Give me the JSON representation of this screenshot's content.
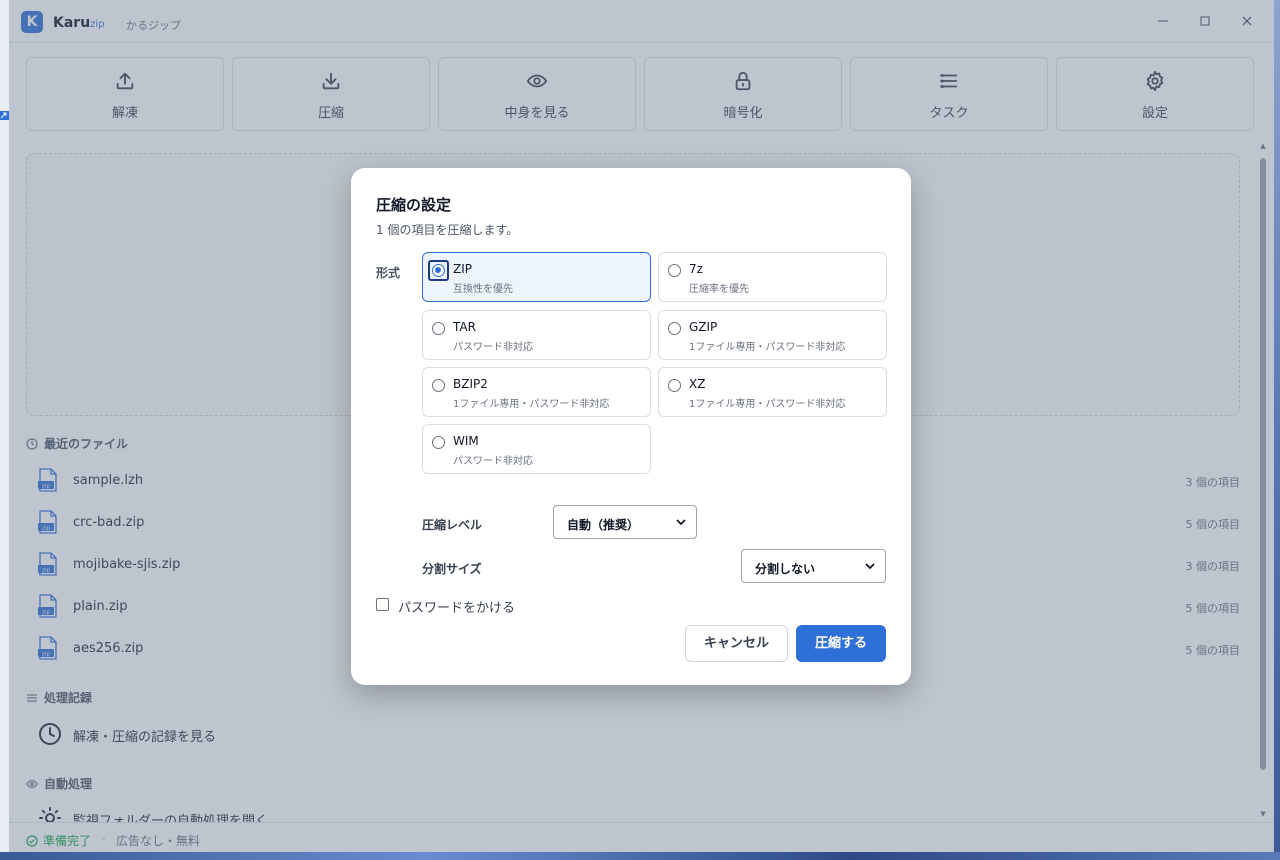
{
  "app": {
    "logo_letter": "K",
    "name": "Karu",
    "name_suffix": "zip",
    "kana": "かるジップ",
    "accent": "#2f6fd8"
  },
  "window_controls": {
    "minimize": "—",
    "maximize": "□",
    "close": "✕"
  },
  "toolbar": [
    {
      "label": "解凍",
      "icon": "upload-icon"
    },
    {
      "label": "圧縮",
      "icon": "download-icon"
    },
    {
      "label": "中身を見る",
      "icon": "eye-icon"
    },
    {
      "label": "暗号化",
      "icon": "lock-icon"
    },
    {
      "label": "タスク",
      "icon": "list-icon"
    },
    {
      "label": "設定",
      "icon": "gear-icon"
    }
  ],
  "recent": {
    "heading": "最近のファイル",
    "files": [
      {
        "name": "sample.lzh",
        "count": "3 個の項目"
      },
      {
        "name": "crc-bad.zip",
        "count": "5 個の項目"
      },
      {
        "name": "mojibake-sjis.zip",
        "count": "3 個の項目"
      },
      {
        "name": "plain.zip",
        "count": "5 個の項目"
      },
      {
        "name": "aes256.zip",
        "count": "5 個の項目"
      }
    ],
    "file_badge": "zip"
  },
  "history": {
    "heading": "処理記録",
    "action": "解凍・圧縮の記録を見る"
  },
  "auto": {
    "heading": "自動処理",
    "action": "監視フォルダーの自動処理を開く"
  },
  "status": {
    "ready": "準備完了",
    "separator": "·",
    "ad": "広告なし・無料"
  },
  "dialog": {
    "title": "圧縮の設定",
    "description": "1 個の項目を圧縮します。",
    "format_label": "形式",
    "formats": [
      {
        "name": "ZIP",
        "note": "互換性を優先",
        "selected": true
      },
      {
        "name": "7z",
        "note": "圧縮率を優先",
        "selected": false
      },
      {
        "name": "TAR",
        "note": "パスワード非対応",
        "selected": false
      },
      {
        "name": "GZIP",
        "note": "1ファイル専用・パスワード非対応",
        "selected": false
      },
      {
        "name": "BZIP2",
        "note": "1ファイル専用・パスワード非対応",
        "selected": false
      },
      {
        "name": "XZ",
        "note": "1ファイル専用・パスワード非対応",
        "selected": false
      },
      {
        "name": "WIM",
        "note": "パスワード非対応",
        "selected": false
      }
    ],
    "level_label": "圧縮レベル",
    "level_value": "自動（推奨）",
    "split_label": "分割サイズ",
    "split_value": "分割しない",
    "password_label": "パスワードをかける",
    "password_checked": false,
    "cancel_label": "キャンセル",
    "ok_label": "圧縮する"
  }
}
